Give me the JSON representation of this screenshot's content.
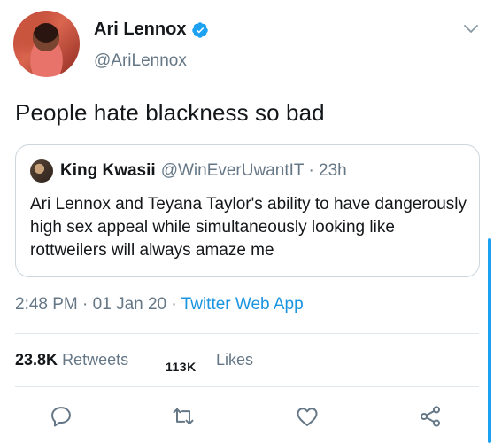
{
  "tweet": {
    "author": {
      "display_name": "Ari Lennox",
      "handle": "@AriLennox",
      "verified": true
    },
    "text": "People hate blackness so bad",
    "quoted": {
      "display_name": "King Kwasii",
      "handle_time": "@WinEverUwantIT · 23h",
      "text": "Ari Lennox and Teyana Taylor's ability to have dangerously high sex appeal while simultaneously looking like rottweilers will always amaze me"
    },
    "meta": {
      "time": "2:48 PM",
      "date": "01 Jan 20",
      "separator": " · ",
      "source": "Twitter Web App"
    },
    "stats": {
      "retweets_count": "23.8K",
      "retweets_label": "Retweets",
      "likes_count": "113K",
      "likes_label": "Likes"
    }
  },
  "icons": {
    "verified": "verified-badge-icon",
    "more": "chevron-down-icon",
    "reply": "reply-icon",
    "retweet": "retweet-icon",
    "like": "heart-icon",
    "share": "share-icon"
  },
  "colors": {
    "link": "#1b95e0",
    "verified": "#1da1f2",
    "muted": "#657786",
    "text": "#14171a"
  }
}
